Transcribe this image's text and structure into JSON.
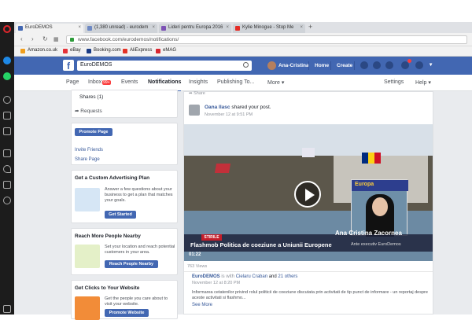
{
  "browser": {
    "tabs": [
      {
        "label": "EuroDEMOS",
        "color": "#4267b2"
      },
      {
        "label": "(1,380 unread) - eurodem",
        "color": "#6e89c4"
      },
      {
        "label": "Lideri pentru Europa 2016",
        "color": "#7d52b5"
      },
      {
        "label": "Kylie Minogue - Stop Me",
        "color": "#e52d27"
      }
    ],
    "new_tab": "+",
    "url": "www.facebook.com/eurodemos/notifications/",
    "bookmarks": [
      {
        "label": "Amazon.co.uk",
        "color": "#f19e1b"
      },
      {
        "label": "eBay",
        "color": "#e53238"
      },
      {
        "label": "Booking.com",
        "color": "#1a3b84"
      },
      {
        "label": "AliExpress",
        "color": "#e43225"
      },
      {
        "label": "eMAG",
        "color": "#d9262f"
      }
    ]
  },
  "fb": {
    "logo": "f",
    "search_value": "EuroDEMOS",
    "user": "Ana-Cristina",
    "nav": [
      "Home",
      "Create"
    ],
    "brand_color": "#4267b2"
  },
  "page_nav": {
    "items": [
      {
        "label": "Page"
      },
      {
        "label": "Inbox",
        "badge": "99+"
      },
      {
        "label": "Events"
      },
      {
        "label": "Notifications"
      },
      {
        "label": "Insights"
      },
      {
        "label": "Publishing To..."
      },
      {
        "label": "More ▾"
      }
    ],
    "settings": "Settings",
    "help": "Help ▾"
  },
  "left": {
    "shares": "Shares (1)",
    "requests": "Requests",
    "promote_page": "Promote Page",
    "invite_friends": "Invite Friends",
    "share_page": "Share Page",
    "ad_plan": {
      "title": "Get a Custom Advertising Plan",
      "desc": "Answer a few questions about your business to get a plan that matches your goals.",
      "button": "Get Started"
    },
    "reach": {
      "title": "Reach More People Nearby",
      "desc": "Set your location and reach potential customers in your area.",
      "button": "Reach People Nearby"
    },
    "clicks": {
      "title": "Get Clicks to Your Website",
      "desc": "Get the people you care about to visit your website.",
      "button": "Promote Website"
    }
  },
  "feed": {
    "share_top": "Share",
    "post_author": "Oana Ilasc",
    "post_action": "shared your post.",
    "post_time": "November 12 at 9:51 PM",
    "video": {
      "inset_header": "Europa",
      "tag": "STIRILE",
      "name": "Ana Cristina Zacornea",
      "headline": "Flashmob Politica de coeziune a Uniunii Europene",
      "role": "Ante executiv EuroDemos",
      "duration": "01:22"
    },
    "views": "763 Views",
    "sub_author": "EuroDEMOS",
    "sub_with": "is with",
    "sub_person": "Cielaru Craban",
    "sub_and": "and",
    "sub_others": "21 others",
    "sub_time": "November 12 at 8:20 PM",
    "sub_text": "Informarea cetatenilor privind rolul politicii de coeziune discutata prin activitati de tip punct de informare - un reportaj despre aceste activitati si flashmo...",
    "see_more": "See More"
  }
}
